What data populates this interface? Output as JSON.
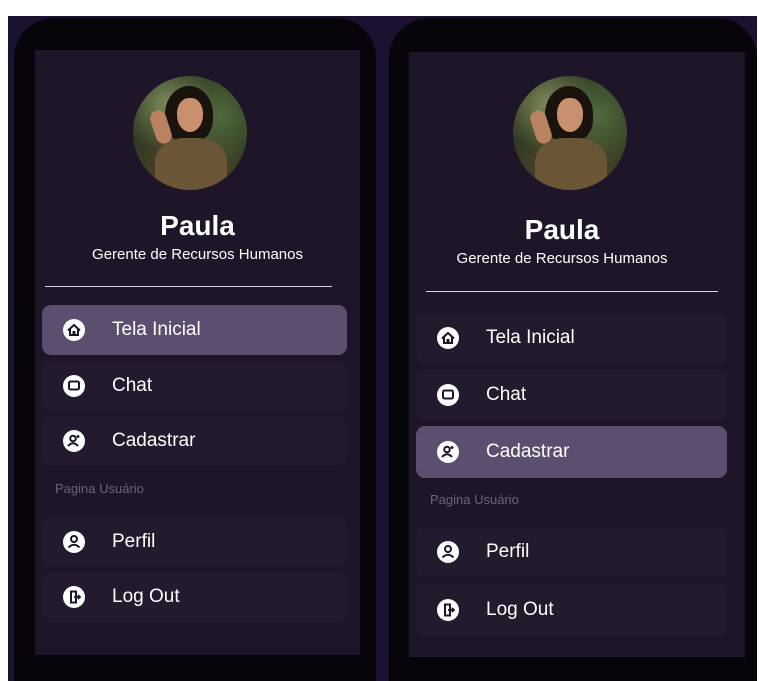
{
  "screens": [
    {
      "profile": {
        "name": "Paula",
        "role": "Gerente de Recursos Humanos"
      },
      "menu": [
        {
          "label": "Tela Inicial",
          "icon": "home-icon",
          "active": true
        },
        {
          "label": "Chat",
          "icon": "chat-icon",
          "active": false
        },
        {
          "label": "Cadastrar",
          "icon": "add-user-icon",
          "active": false
        }
      ],
      "section_label": "Pagina Usuário",
      "user_menu": [
        {
          "label": "Perfil",
          "icon": "user-icon"
        },
        {
          "label": "Log Out",
          "icon": "logout-icon"
        }
      ]
    },
    {
      "profile": {
        "name": "Paula",
        "role": "Gerente de Recursos Humanos"
      },
      "menu": [
        {
          "label": "Tela Inicial",
          "icon": "home-icon",
          "active": false
        },
        {
          "label": "Chat",
          "icon": "chat-icon",
          "active": false
        },
        {
          "label": "Cadastrar",
          "icon": "add-user-icon",
          "active": true
        }
      ],
      "section_label": "Pagina Usuário",
      "user_menu": [
        {
          "label": "Perfil",
          "icon": "user-icon"
        },
        {
          "label": "Log Out",
          "icon": "logout-icon"
        }
      ]
    }
  ],
  "colors": {
    "panel": "#1f1528",
    "item": "#241a2e",
    "active_item": "#5b4e6e",
    "frame": "#070509",
    "backdrop": "#1c1131"
  }
}
